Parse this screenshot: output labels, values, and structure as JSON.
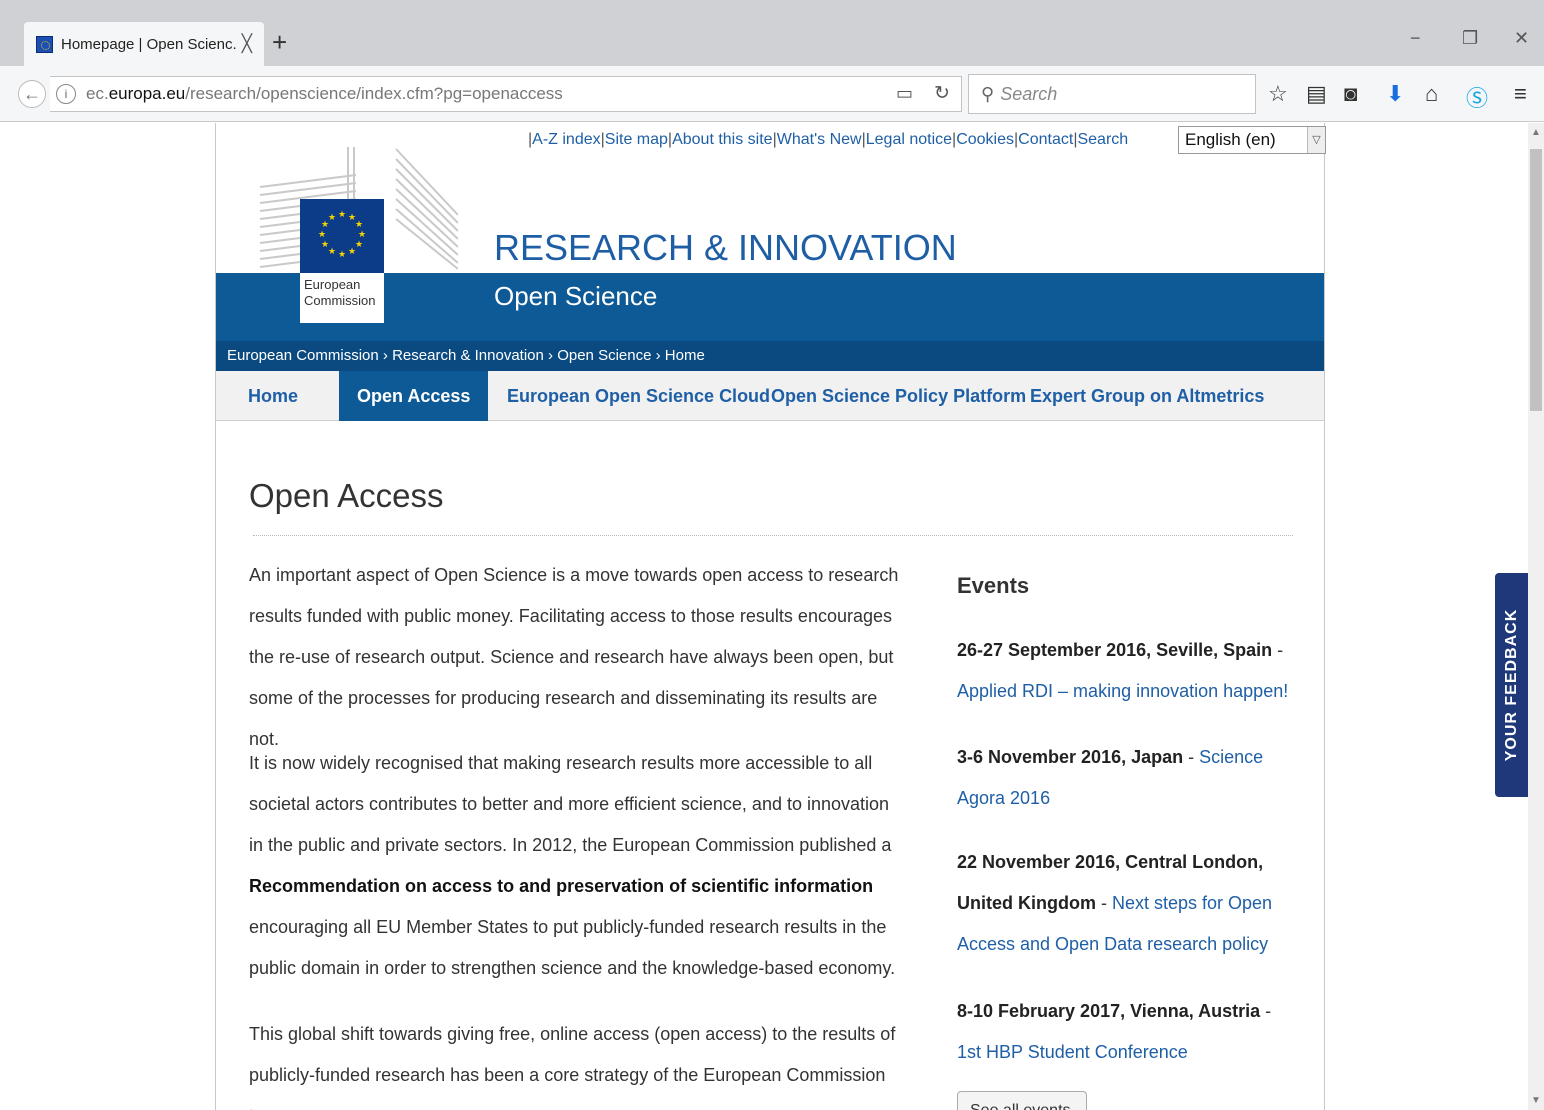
{
  "browser": {
    "tab_title": "Homepage | Open Scienc...",
    "tab_close": "╳",
    "new_tab": "+",
    "url_host_prefix": "ec.",
    "url_host": "europa.eu",
    "url_path": "/research/openscience/index.cfm?pg=openaccess",
    "search_placeholder": "Search",
    "window_minimize": "−",
    "window_restore": "❐",
    "window_close": "✕"
  },
  "toplinks": {
    "separator": "|",
    "items": [
      "A-Z index",
      "Site map",
      "About this site",
      "What's New",
      "Legal notice",
      "Cookies",
      "Contact",
      "Search"
    ]
  },
  "language": {
    "selected": "English (en)"
  },
  "header": {
    "logo_line1": "European",
    "logo_line2": "Commission",
    "site_title": "RESEARCH & INNOVATION",
    "site_subtitle": "Open Science"
  },
  "breadcrumb": {
    "items": [
      "European Commission",
      "Research & Innovation",
      "Open Science",
      "Home"
    ]
  },
  "menu": {
    "items": [
      "Home",
      "Open Access",
      "European Open Science Cloud",
      "Open Science Policy Platform",
      "Expert Group on Altmetrics"
    ],
    "active": "Open Access"
  },
  "main": {
    "title": "Open Access",
    "para1": "An important aspect of Open Science is a move towards open access to research results funded with public money. Facilitating access to those results encourages the re-use of research output. Science and research have always been open, but some of the processes for producing research and disseminating its results are not.",
    "para2_a": "It is now widely recognised that making research results more accessible to all societal actors contributes to better and more efficient science, and to innovation in the public and private sectors. In 2012, the European Commission published a ",
    "para2_b": "Recommendation on access to and preservation of scientific information",
    "para2_c": " encouraging all EU Member States to put publicly-funded research results in the public domain in order to strengthen science and the knowledge-based economy.",
    "para3": "This global shift towards giving free, online access (open access) to the results of publicly-funded research has been a core strategy of the European Commission to"
  },
  "events": {
    "heading": "Events",
    "items": [
      {
        "when": "26-27 September 2016, Seville, Spain",
        "sep": " - ",
        "link": "Applied RDI – making innovation happen!"
      },
      {
        "when": "3-6 November 2016, Japan",
        "sep": " - ",
        "link": "Science Agora 2016"
      },
      {
        "when": "22 November 2016, Central London, United Kingdom",
        "sep": " - ",
        "link": "Next steps for Open Access and Open Data research policy"
      },
      {
        "when": "8-10 February 2017, Vienna, Austria",
        "sep": " - ",
        "link": "1st HBP Student Conference"
      }
    ],
    "see_all": "See all events"
  },
  "feedback": {
    "label": "YOUR FEEDBACK"
  }
}
